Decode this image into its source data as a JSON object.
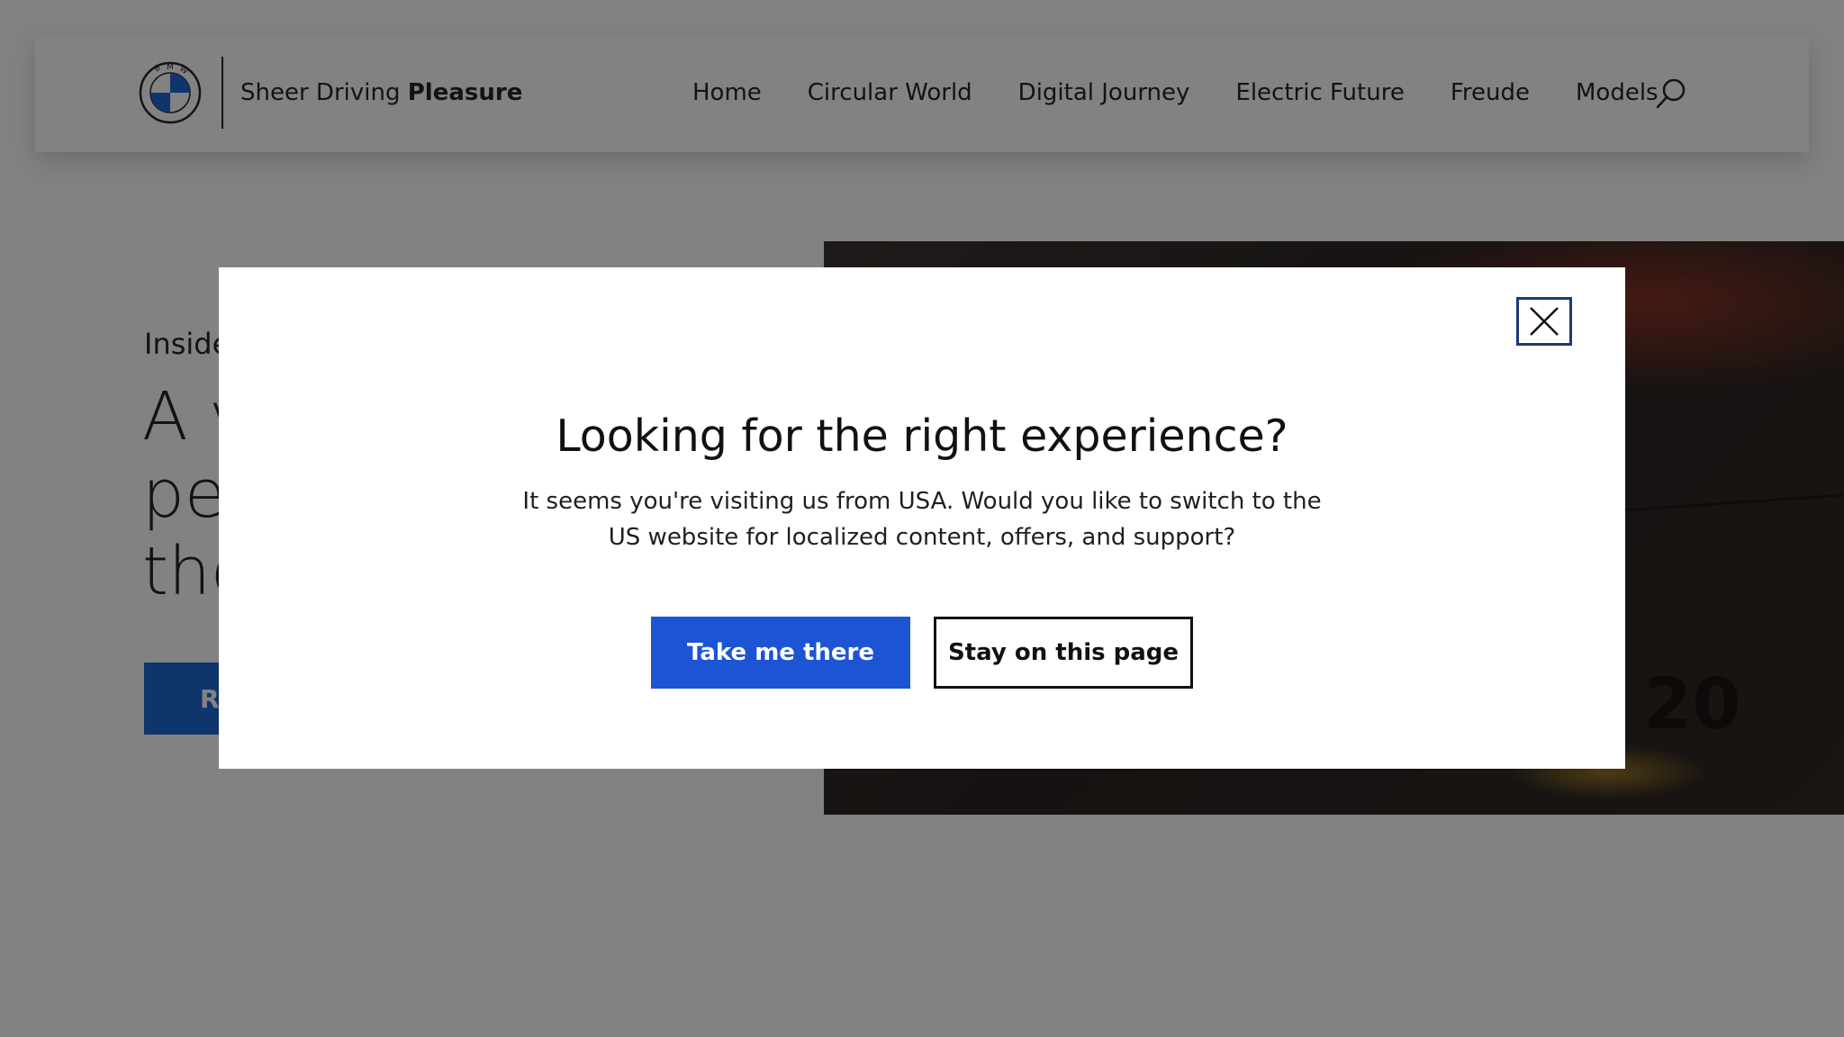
{
  "header": {
    "logo": "bmw-logo",
    "logo_letters": "BMW",
    "tagline_regular": "Sheer Driving",
    "tagline_bold": "Pleasure",
    "nav": [
      {
        "label": "Home"
      },
      {
        "label": "Circular World"
      },
      {
        "label": "Digital Journey"
      },
      {
        "label": "Electric Future"
      },
      {
        "label": "Freude"
      },
      {
        "label": "Models"
      }
    ],
    "search_icon": "search-icon"
  },
  "hero": {
    "eyebrow": "Inside",
    "title_lines": [
      "A v",
      "peo",
      "the"
    ],
    "cta_label": "R",
    "image_text": "20"
  },
  "modal": {
    "title": "Looking for the right experience?",
    "body": "It seems you're visiting us from USA. Would you like to switch to the US website for localized content, offers, and support?",
    "primary_label": "Take me there",
    "secondary_label": "Stay on this page",
    "close_icon": "close-icon"
  },
  "colors": {
    "accent_blue": "#1c54d4",
    "overlay": "rgba(0,0,0,0.49)",
    "logo_blue": "#1c69d4",
    "close_border": "#1a3a7a"
  }
}
